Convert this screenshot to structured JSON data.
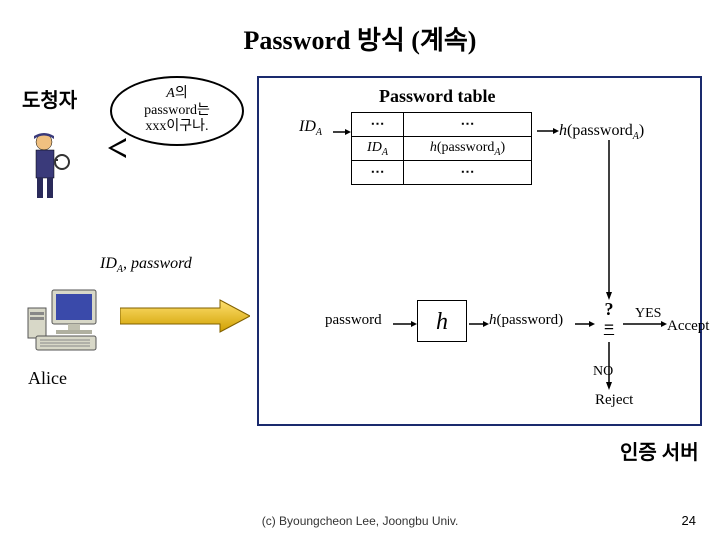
{
  "title": "Password 방식 (계속)",
  "eavesdropper_label": "도청자",
  "bubble": {
    "line1": "A의",
    "line2": "password는",
    "line3": "xxx이구나."
  },
  "pwtable_title": "Password table",
  "table_rows": [
    {
      "c1": "⋯",
      "c2": "⋯"
    },
    {
      "c1": "IDA",
      "c2": "h(passwordA)"
    },
    {
      "c1": "⋯",
      "c2": "⋯"
    }
  ],
  "ida_arrow_label": "IDA",
  "hpass_label": "h(passwordA)",
  "password_in": "password",
  "hbox": "h",
  "hpassword_out": "h(password)",
  "compare": "?\\n=",
  "yes": "YES",
  "accept": "Accept",
  "no": "NO",
  "reject": "Reject",
  "server_label": "인증 서버",
  "idapw": "IDA, password",
  "alice": "Alice",
  "footer": "(c) Byoungcheon Lee, Joongbu Univ.",
  "page": "24"
}
